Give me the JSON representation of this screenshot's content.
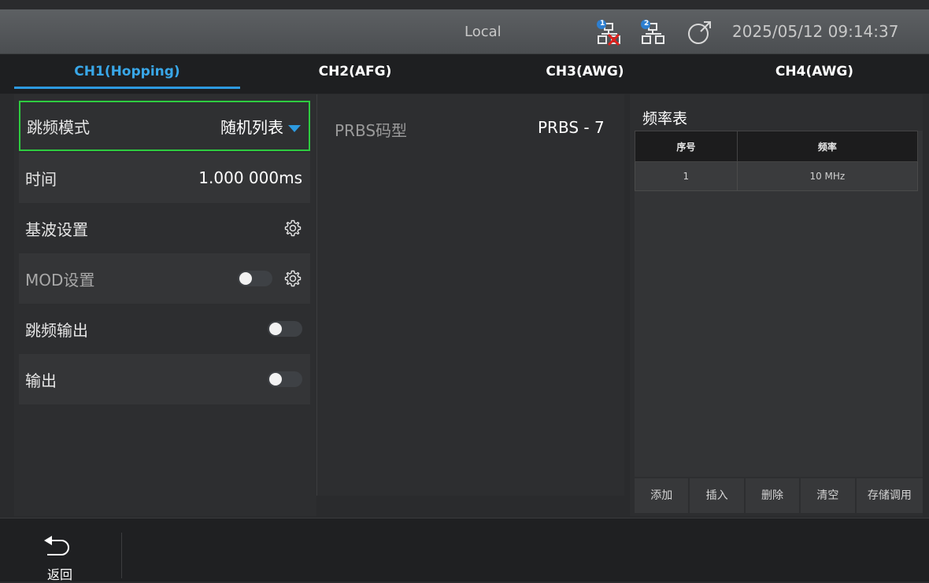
{
  "status_bar": {
    "mode": "Local",
    "datetime": "2025/05/12 09:14:37",
    "net1_badge": "1",
    "net2_badge": "2"
  },
  "tabs": [
    {
      "label": "CH1(Hopping)",
      "active": true
    },
    {
      "label": "CH2(AFG)",
      "active": false
    },
    {
      "label": "CH3(AWG)",
      "active": false
    },
    {
      "label": "CH4(AWG)",
      "active": false
    }
  ],
  "left_panel": {
    "rows": [
      {
        "label": "跳频模式",
        "value": "随机列表"
      },
      {
        "label": "时间",
        "value": "1.000 000ms"
      },
      {
        "label": "基波设置"
      },
      {
        "label": "MOD设置"
      },
      {
        "label": "跳频输出"
      },
      {
        "label": "输出"
      }
    ]
  },
  "middle_panel": {
    "label": "PRBS码型",
    "value": "PRBS - 7"
  },
  "freq_table": {
    "title": "频率表",
    "columns": [
      "序号",
      "频率"
    ],
    "rows": [
      [
        "1",
        "10 MHz"
      ]
    ],
    "buttons": [
      "添加",
      "插入",
      "删除",
      "清空",
      "存储调用"
    ]
  },
  "bottom_bar": {
    "back_label": "返回"
  },
  "colors": {
    "accent": "#2d9ae0",
    "selected_border": "#2ecc40"
  }
}
